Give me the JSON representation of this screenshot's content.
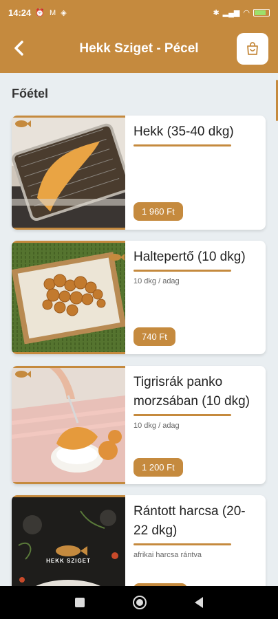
{
  "status_bar": {
    "time": "14:24",
    "battery_percent": 70
  },
  "app_bar": {
    "title": "Hekk Sziget - Pécel"
  },
  "section": {
    "title": "Főétel"
  },
  "items": [
    {
      "name": "Hekk (35-40 dkg)",
      "description": "",
      "price": "1 960 Ft",
      "image": "fish-frying-basket"
    },
    {
      "name": "Haltepertő (10 dkg)",
      "description": "10 dkg / adag",
      "price": "740 Ft",
      "image": "fried-fish-bites-box"
    },
    {
      "name": "Tigrisrák panko morzsában (10 dkg)",
      "description": "10 dkg / adag",
      "price": "1 200 Ft",
      "image": "breaded-shrimp-fork"
    },
    {
      "name": "Rántott harcsa (20-22 dkg)",
      "description": "afrikai harcsa rántva",
      "price": "",
      "image": "hekk-sziget-logo"
    }
  ],
  "logo_text": "HEKK SZIGET",
  "colors": {
    "accent": "#c58a3e",
    "background": "#e9eef1"
  }
}
